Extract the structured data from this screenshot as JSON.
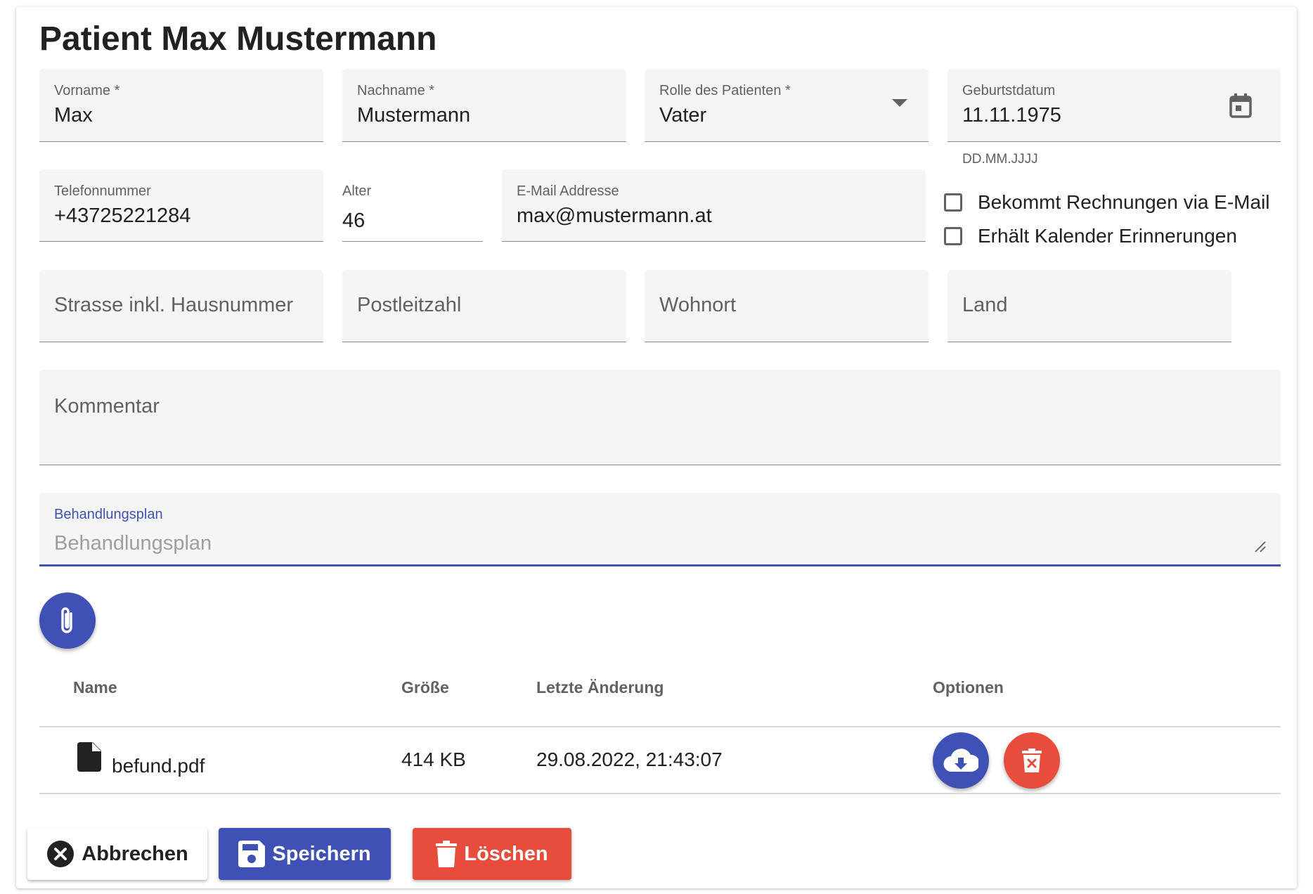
{
  "title": "Patient Max Mustermann",
  "fields": {
    "vorname": {
      "label": "Vorname *",
      "value": "Max"
    },
    "nachname": {
      "label": "Nachname *",
      "value": "Mustermann"
    },
    "rolle": {
      "label": "Rolle des Patienten *",
      "value": "Vater"
    },
    "geburtsdatum": {
      "label": "Geburtstdatum",
      "value": "11.11.1975",
      "hint": "DD.MM.JJJJ"
    },
    "telefon": {
      "label": "Telefonnummer",
      "value": "+43725221284"
    },
    "alter": {
      "label": "Alter",
      "value": "46"
    },
    "email": {
      "label": "E-Mail Addresse",
      "value": "max@mustermann.at"
    },
    "strasse": {
      "placeholder": "Strasse inkl. Hausnummer"
    },
    "plz": {
      "placeholder": "Postleitzahl"
    },
    "wohnort": {
      "placeholder": "Wohnort"
    },
    "land": {
      "placeholder": "Land"
    },
    "kommentar": {
      "placeholder": "Kommentar"
    },
    "behandlungsplan": {
      "label": "Behandlungsplan",
      "placeholder": "Behandlungsplan"
    }
  },
  "checkboxes": [
    {
      "label": "Bekommt Rechnungen via E-Mail",
      "checked": false
    },
    {
      "label": "Erhält Kalender Erinnerungen",
      "checked": false
    }
  ],
  "files": {
    "columns": [
      "Name",
      "Größe",
      "Letzte Änderung",
      "Optionen"
    ],
    "rows": [
      {
        "name": "befund.pdf",
        "size": "414 KB",
        "modified": "29.08.2022, 21:43:07"
      }
    ]
  },
  "buttons": {
    "cancel": "Abbrechen",
    "save": "Speichern",
    "delete": "Löschen"
  },
  "icons": {
    "attach": "paperclip-icon",
    "calendar": "calendar-icon",
    "dropdown": "caret-down-icon",
    "file": "file-icon",
    "download": "cloud-download-icon",
    "delete_file": "trash-x-icon",
    "cancel": "close-circle-icon",
    "save": "floppy-disk-icon",
    "delete": "trash-icon"
  },
  "colors": {
    "primary": "#3f51b5",
    "danger": "#e74c3c",
    "field_bg": "#f5f5f5"
  }
}
